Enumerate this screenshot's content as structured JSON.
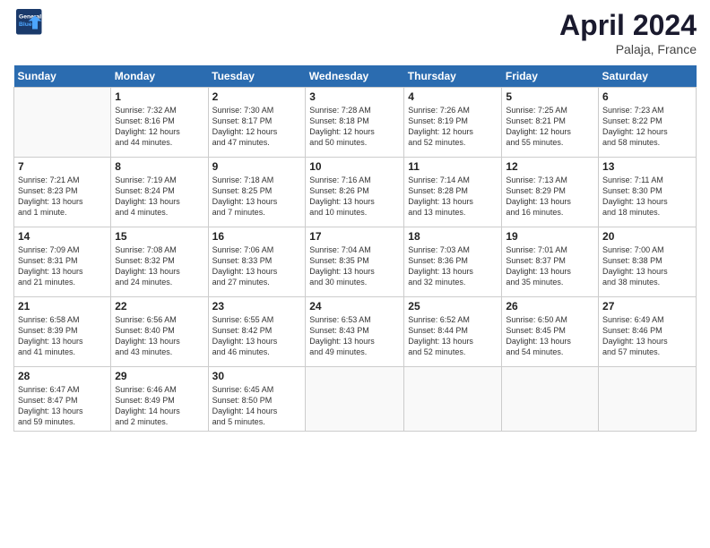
{
  "header": {
    "logo_line1": "General",
    "logo_line2": "Blue",
    "month": "April 2024",
    "location": "Palaja, France"
  },
  "columns": [
    "Sunday",
    "Monday",
    "Tuesday",
    "Wednesday",
    "Thursday",
    "Friday",
    "Saturday"
  ],
  "weeks": [
    [
      {
        "num": "",
        "info": ""
      },
      {
        "num": "1",
        "info": "Sunrise: 7:32 AM\nSunset: 8:16 PM\nDaylight: 12 hours\nand 44 minutes."
      },
      {
        "num": "2",
        "info": "Sunrise: 7:30 AM\nSunset: 8:17 PM\nDaylight: 12 hours\nand 47 minutes."
      },
      {
        "num": "3",
        "info": "Sunrise: 7:28 AM\nSunset: 8:18 PM\nDaylight: 12 hours\nand 50 minutes."
      },
      {
        "num": "4",
        "info": "Sunrise: 7:26 AM\nSunset: 8:19 PM\nDaylight: 12 hours\nand 52 minutes."
      },
      {
        "num": "5",
        "info": "Sunrise: 7:25 AM\nSunset: 8:21 PM\nDaylight: 12 hours\nand 55 minutes."
      },
      {
        "num": "6",
        "info": "Sunrise: 7:23 AM\nSunset: 8:22 PM\nDaylight: 12 hours\nand 58 minutes."
      }
    ],
    [
      {
        "num": "7",
        "info": "Sunrise: 7:21 AM\nSunset: 8:23 PM\nDaylight: 13 hours\nand 1 minute."
      },
      {
        "num": "8",
        "info": "Sunrise: 7:19 AM\nSunset: 8:24 PM\nDaylight: 13 hours\nand 4 minutes."
      },
      {
        "num": "9",
        "info": "Sunrise: 7:18 AM\nSunset: 8:25 PM\nDaylight: 13 hours\nand 7 minutes."
      },
      {
        "num": "10",
        "info": "Sunrise: 7:16 AM\nSunset: 8:26 PM\nDaylight: 13 hours\nand 10 minutes."
      },
      {
        "num": "11",
        "info": "Sunrise: 7:14 AM\nSunset: 8:28 PM\nDaylight: 13 hours\nand 13 minutes."
      },
      {
        "num": "12",
        "info": "Sunrise: 7:13 AM\nSunset: 8:29 PM\nDaylight: 13 hours\nand 16 minutes."
      },
      {
        "num": "13",
        "info": "Sunrise: 7:11 AM\nSunset: 8:30 PM\nDaylight: 13 hours\nand 18 minutes."
      }
    ],
    [
      {
        "num": "14",
        "info": "Sunrise: 7:09 AM\nSunset: 8:31 PM\nDaylight: 13 hours\nand 21 minutes."
      },
      {
        "num": "15",
        "info": "Sunrise: 7:08 AM\nSunset: 8:32 PM\nDaylight: 13 hours\nand 24 minutes."
      },
      {
        "num": "16",
        "info": "Sunrise: 7:06 AM\nSunset: 8:33 PM\nDaylight: 13 hours\nand 27 minutes."
      },
      {
        "num": "17",
        "info": "Sunrise: 7:04 AM\nSunset: 8:35 PM\nDaylight: 13 hours\nand 30 minutes."
      },
      {
        "num": "18",
        "info": "Sunrise: 7:03 AM\nSunset: 8:36 PM\nDaylight: 13 hours\nand 32 minutes."
      },
      {
        "num": "19",
        "info": "Sunrise: 7:01 AM\nSunset: 8:37 PM\nDaylight: 13 hours\nand 35 minutes."
      },
      {
        "num": "20",
        "info": "Sunrise: 7:00 AM\nSunset: 8:38 PM\nDaylight: 13 hours\nand 38 minutes."
      }
    ],
    [
      {
        "num": "21",
        "info": "Sunrise: 6:58 AM\nSunset: 8:39 PM\nDaylight: 13 hours\nand 41 minutes."
      },
      {
        "num": "22",
        "info": "Sunrise: 6:56 AM\nSunset: 8:40 PM\nDaylight: 13 hours\nand 43 minutes."
      },
      {
        "num": "23",
        "info": "Sunrise: 6:55 AM\nSunset: 8:42 PM\nDaylight: 13 hours\nand 46 minutes."
      },
      {
        "num": "24",
        "info": "Sunrise: 6:53 AM\nSunset: 8:43 PM\nDaylight: 13 hours\nand 49 minutes."
      },
      {
        "num": "25",
        "info": "Sunrise: 6:52 AM\nSunset: 8:44 PM\nDaylight: 13 hours\nand 52 minutes."
      },
      {
        "num": "26",
        "info": "Sunrise: 6:50 AM\nSunset: 8:45 PM\nDaylight: 13 hours\nand 54 minutes."
      },
      {
        "num": "27",
        "info": "Sunrise: 6:49 AM\nSunset: 8:46 PM\nDaylight: 13 hours\nand 57 minutes."
      }
    ],
    [
      {
        "num": "28",
        "info": "Sunrise: 6:47 AM\nSunset: 8:47 PM\nDaylight: 13 hours\nand 59 minutes."
      },
      {
        "num": "29",
        "info": "Sunrise: 6:46 AM\nSunset: 8:49 PM\nDaylight: 14 hours\nand 2 minutes."
      },
      {
        "num": "30",
        "info": "Sunrise: 6:45 AM\nSunset: 8:50 PM\nDaylight: 14 hours\nand 5 minutes."
      },
      {
        "num": "",
        "info": ""
      },
      {
        "num": "",
        "info": ""
      },
      {
        "num": "",
        "info": ""
      },
      {
        "num": "",
        "info": ""
      }
    ]
  ]
}
